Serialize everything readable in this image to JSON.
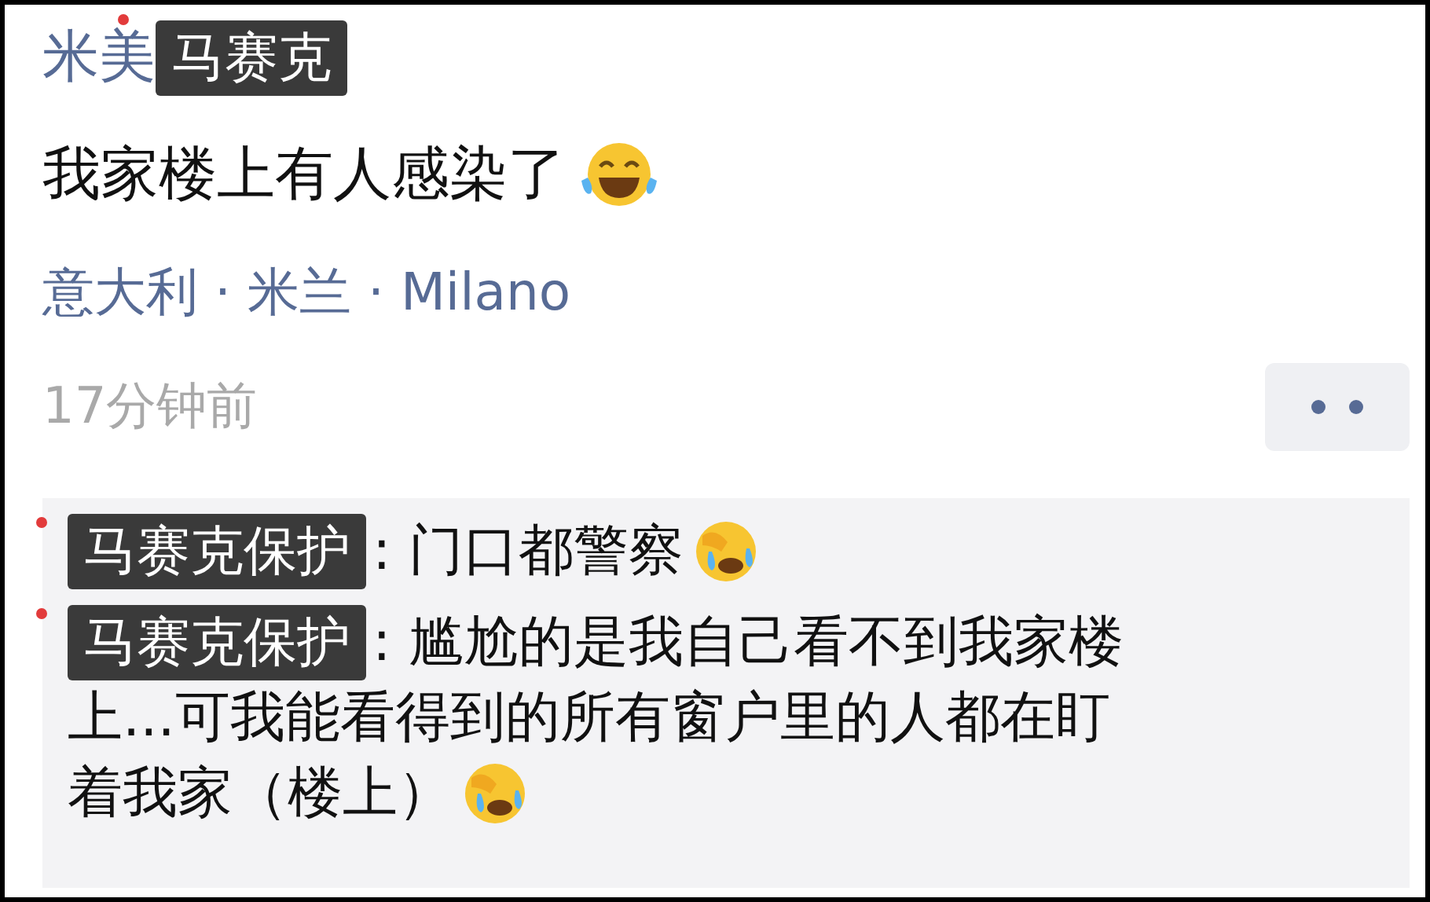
{
  "post": {
    "author": "米美",
    "author_mask": "马赛克",
    "text": "我家楼上有人感染了",
    "location": "意大利 · 米兰 · Milano",
    "time": "17分钟前"
  },
  "comments": [
    {
      "mask": "马赛克保护",
      "lines": [
        ": 门口都警察"
      ]
    },
    {
      "mask": "马赛克保护",
      "lines": [
        ": 尴尬的是我自己看不到我家楼",
        "上...可我能看得到的所有窗户里的人都在盯",
        "着我家（楼上）"
      ]
    }
  ]
}
